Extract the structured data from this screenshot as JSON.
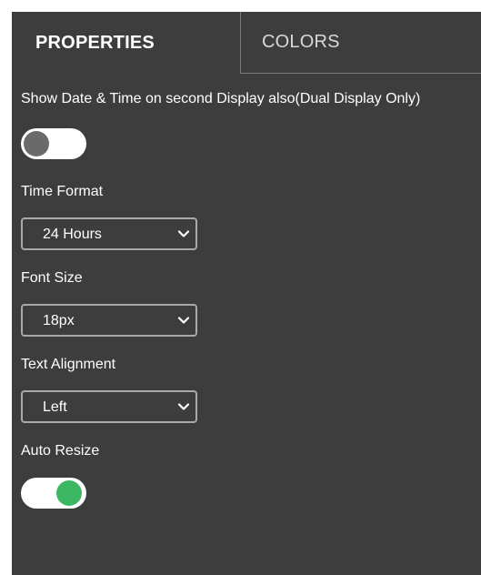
{
  "tabs": {
    "properties": "PROPERTIES",
    "colors": "COLORS"
  },
  "dual_display": {
    "label": "Show Date & Time on second Display also(Dual Display Only)",
    "enabled": false
  },
  "time_format": {
    "label": "Time Format",
    "value": "24 Hours"
  },
  "font_size": {
    "label": "Font Size",
    "value": "18px"
  },
  "text_alignment": {
    "label": "Text Alignment",
    "value": "Left"
  },
  "auto_resize": {
    "label": "Auto Resize",
    "enabled": true
  },
  "colors": {
    "panel_bg": "#3d3d3d",
    "toggle_on": "#3cb862",
    "toggle_off_knob": "#6a6a6a"
  },
  "icons": {
    "select_arrow": "chevron-down-icon"
  }
}
